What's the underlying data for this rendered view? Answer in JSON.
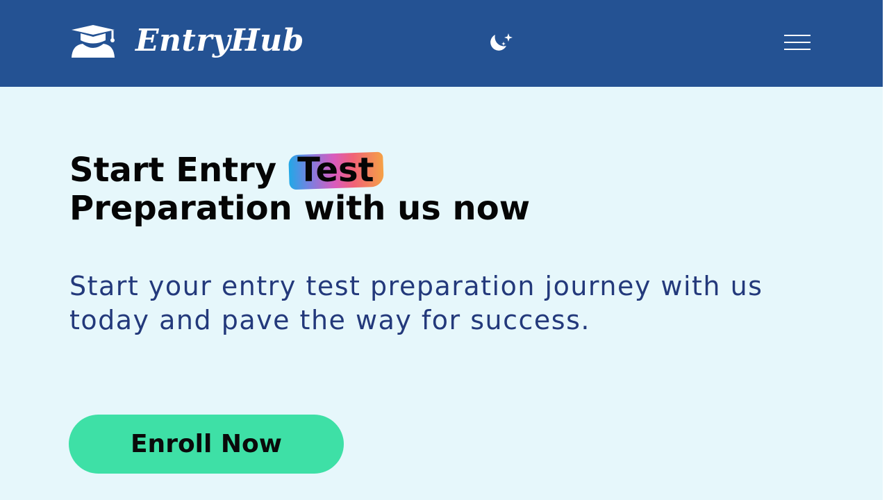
{
  "header": {
    "brand_name": "EntryHub",
    "logo_icon": "graduate-cap-icon",
    "theme_icon": "moon-stars-icon",
    "menu_icon": "hamburger-menu-icon",
    "background_color": "#245293"
  },
  "hero": {
    "title_part1": "Start Entry",
    "title_highlight": "Test",
    "title_part2": "Preparation with us now",
    "description": "Start your entry test preparation journey with us today and pave the way for success.",
    "cta_label": "Enroll Now",
    "background_color": "#e6f7fb",
    "cta_color": "#3ee0a6",
    "description_color": "#23397b"
  }
}
